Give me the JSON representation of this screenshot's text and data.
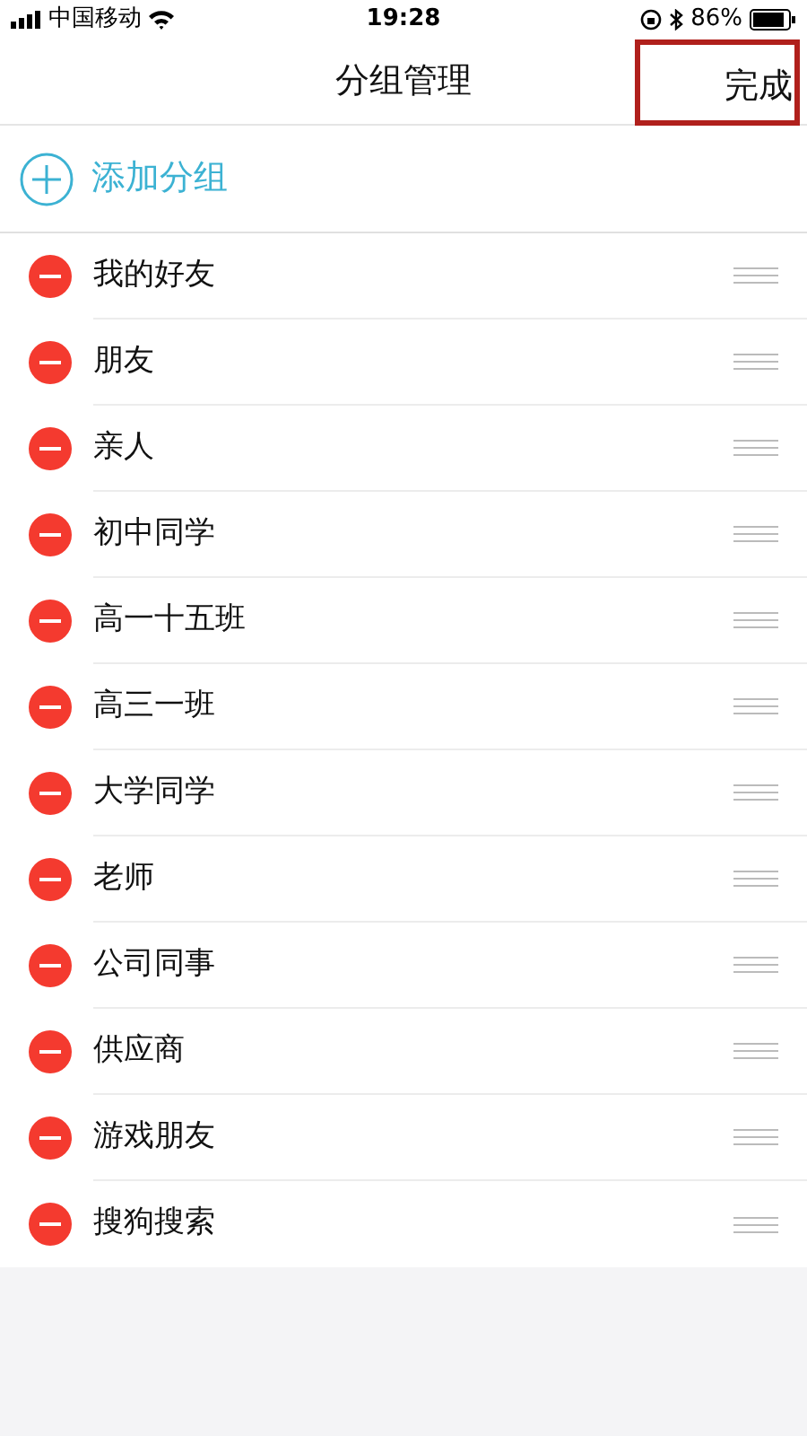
{
  "status_bar": {
    "carrier": "中国移动",
    "time": "19:28",
    "battery": "86%"
  },
  "nav": {
    "title": "分组管理",
    "done": "完成",
    "highlighted": true
  },
  "add_group": {
    "label": "添加分组"
  },
  "groups": [
    {
      "name": "我的好友"
    },
    {
      "name": "朋友"
    },
    {
      "name": "亲人"
    },
    {
      "name": "初中同学"
    },
    {
      "name": "高一十五班"
    },
    {
      "name": "高三一班"
    },
    {
      "name": "大学同学"
    },
    {
      "name": "老师"
    },
    {
      "name": "公司同事"
    },
    {
      "name": "供应商"
    },
    {
      "name": "游戏朋友"
    },
    {
      "name": "搜狗搜索"
    }
  ]
}
